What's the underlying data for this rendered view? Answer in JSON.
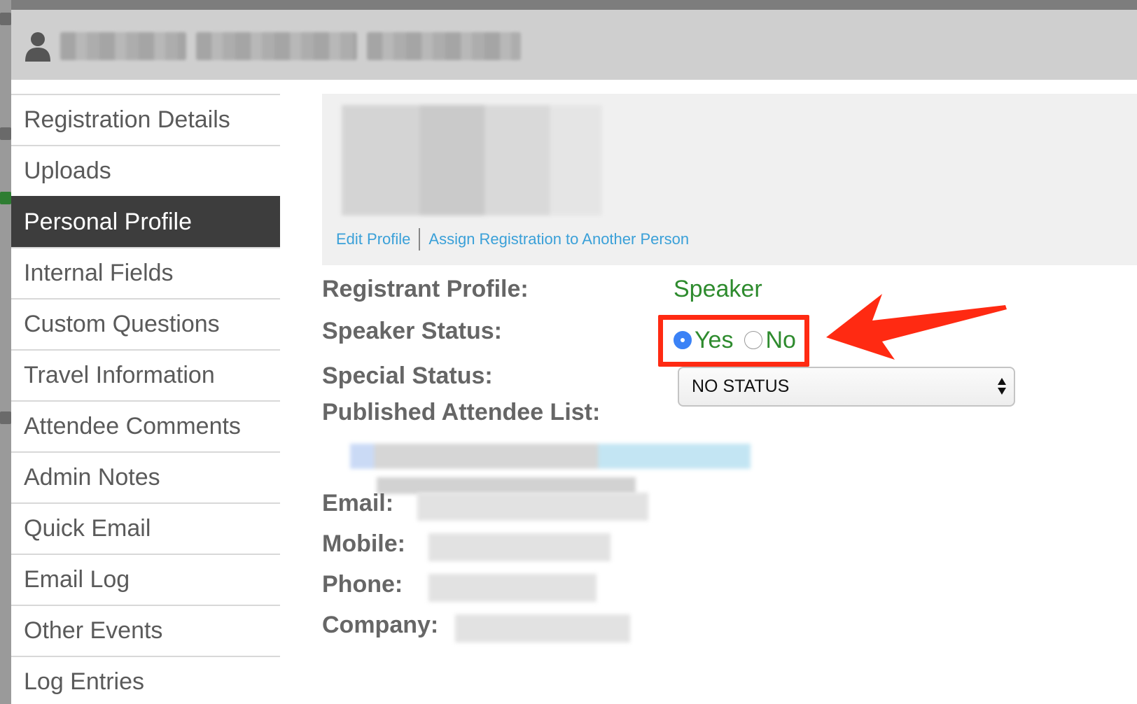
{
  "header": {
    "icon": "user-icon",
    "name_redacted": true
  },
  "sidebar": {
    "items": [
      {
        "label": "Registration Details",
        "active": false
      },
      {
        "label": "Uploads",
        "active": false
      },
      {
        "label": "Personal Profile",
        "active": true
      },
      {
        "label": "Internal Fields",
        "active": false
      },
      {
        "label": "Custom Questions",
        "active": false
      },
      {
        "label": "Travel Information",
        "active": false
      },
      {
        "label": "Attendee Comments",
        "active": false
      },
      {
        "label": "Admin Notes",
        "active": false
      },
      {
        "label": "Quick Email",
        "active": false
      },
      {
        "label": "Email Log",
        "active": false
      },
      {
        "label": "Other Events",
        "active": false
      },
      {
        "label": "Log Entries",
        "active": false
      }
    ]
  },
  "profile": {
    "edit_link": "Edit Profile",
    "assign_link": "Assign Registration to Another Person"
  },
  "fields": {
    "registrant_profile_label": "Registrant Profile:",
    "registrant_profile_value": "Speaker",
    "speaker_status_label": "Speaker Status:",
    "speaker_status_yes": "Yes",
    "speaker_status_no": "No",
    "speaker_status_selected": "Yes",
    "special_status_label": "Special Status:",
    "special_status_value": "NO STATUS",
    "published_list_label": "Published Attendee List:",
    "email_label": "Email:",
    "mobile_label": "Mobile:",
    "phone_label": "Phone:",
    "company_label": "Company:"
  },
  "colors": {
    "accent_link": "#3aa0d8",
    "value_green": "#2e8b2e",
    "highlight_red": "#ff2a12",
    "active_item_bg": "#3d3d3d",
    "radio_blue": "#3b82f6"
  }
}
